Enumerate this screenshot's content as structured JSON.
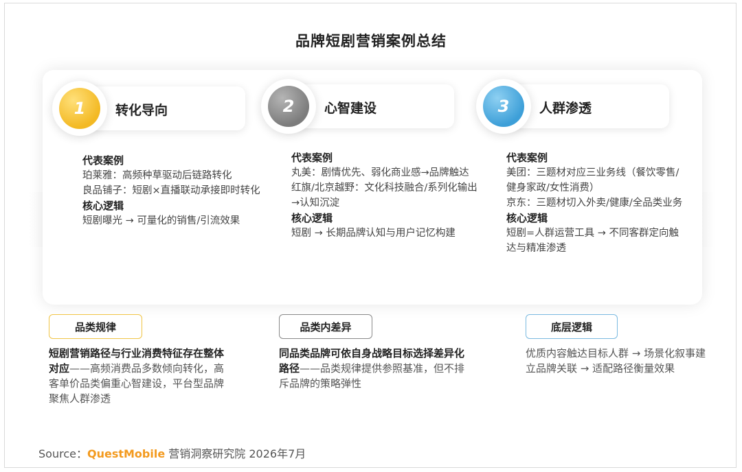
{
  "title": "品牌短剧营销案例总结",
  "columns": [
    {
      "number": "1",
      "label": "转化导向",
      "cases_heading": "代表案例",
      "cases": [
        "珀莱雅：高频种草驱动后链路转化",
        "良品铺子：短剧×直播联动承接即时转化"
      ],
      "logic_heading": "核心逻辑",
      "logic": "短剧曝光 → 可量化的销售/引流效果"
    },
    {
      "number": "2",
      "label": "心智建设",
      "cases_heading": "代表案例",
      "cases": [
        "丸美：剧情优先、弱化商业感→品牌触达",
        "红旗/北京越野：文化科技融合/系列化输出→认知沉淀"
      ],
      "logic_heading": "核心逻辑",
      "logic": "短剧 → 长期品牌认知与用户记忆构建"
    },
    {
      "number": "3",
      "label": "人群渗透",
      "cases_heading": "代表案例",
      "cases": [
        "美团：三题材对应三业务线（餐饮零售/健身家政/女性消费）",
        "京东：三题材切入外卖/健康/全品类业务"
      ],
      "logic_heading": "核心逻辑",
      "logic": "短剧=人群运营工具 → 不同客群定向触达与精准渗透"
    }
  ],
  "summaries": [
    {
      "tag": "品类规律",
      "bold": "短剧营销路径与行业消费特征存在整体对应",
      "text": "——高频消费品多数倾向转化，高客单价品类偏重心智建设，平台型品牌聚焦人群渗透"
    },
    {
      "tag": "品类内差异",
      "bold": "同品类品牌可依自身战略目标选择差异化路径",
      "text": "——品类规律提供参照基准，但不排斥品牌的策略弹性"
    },
    {
      "tag": "底层逻辑",
      "bold": "",
      "text": "优质内容触达目标人群 → 场景化叙事建立品牌关联 → 适配路径衡量效果"
    }
  ],
  "source": {
    "prefix": "Source：",
    "brand": "QuestMobile",
    "suffix": "营销洞察研究院 2026年7月"
  },
  "colors": {
    "badge1": "#f3b923",
    "badge2": "#7c7c7c",
    "badge3": "#3d9fd8",
    "brand": "#f39a1e"
  }
}
